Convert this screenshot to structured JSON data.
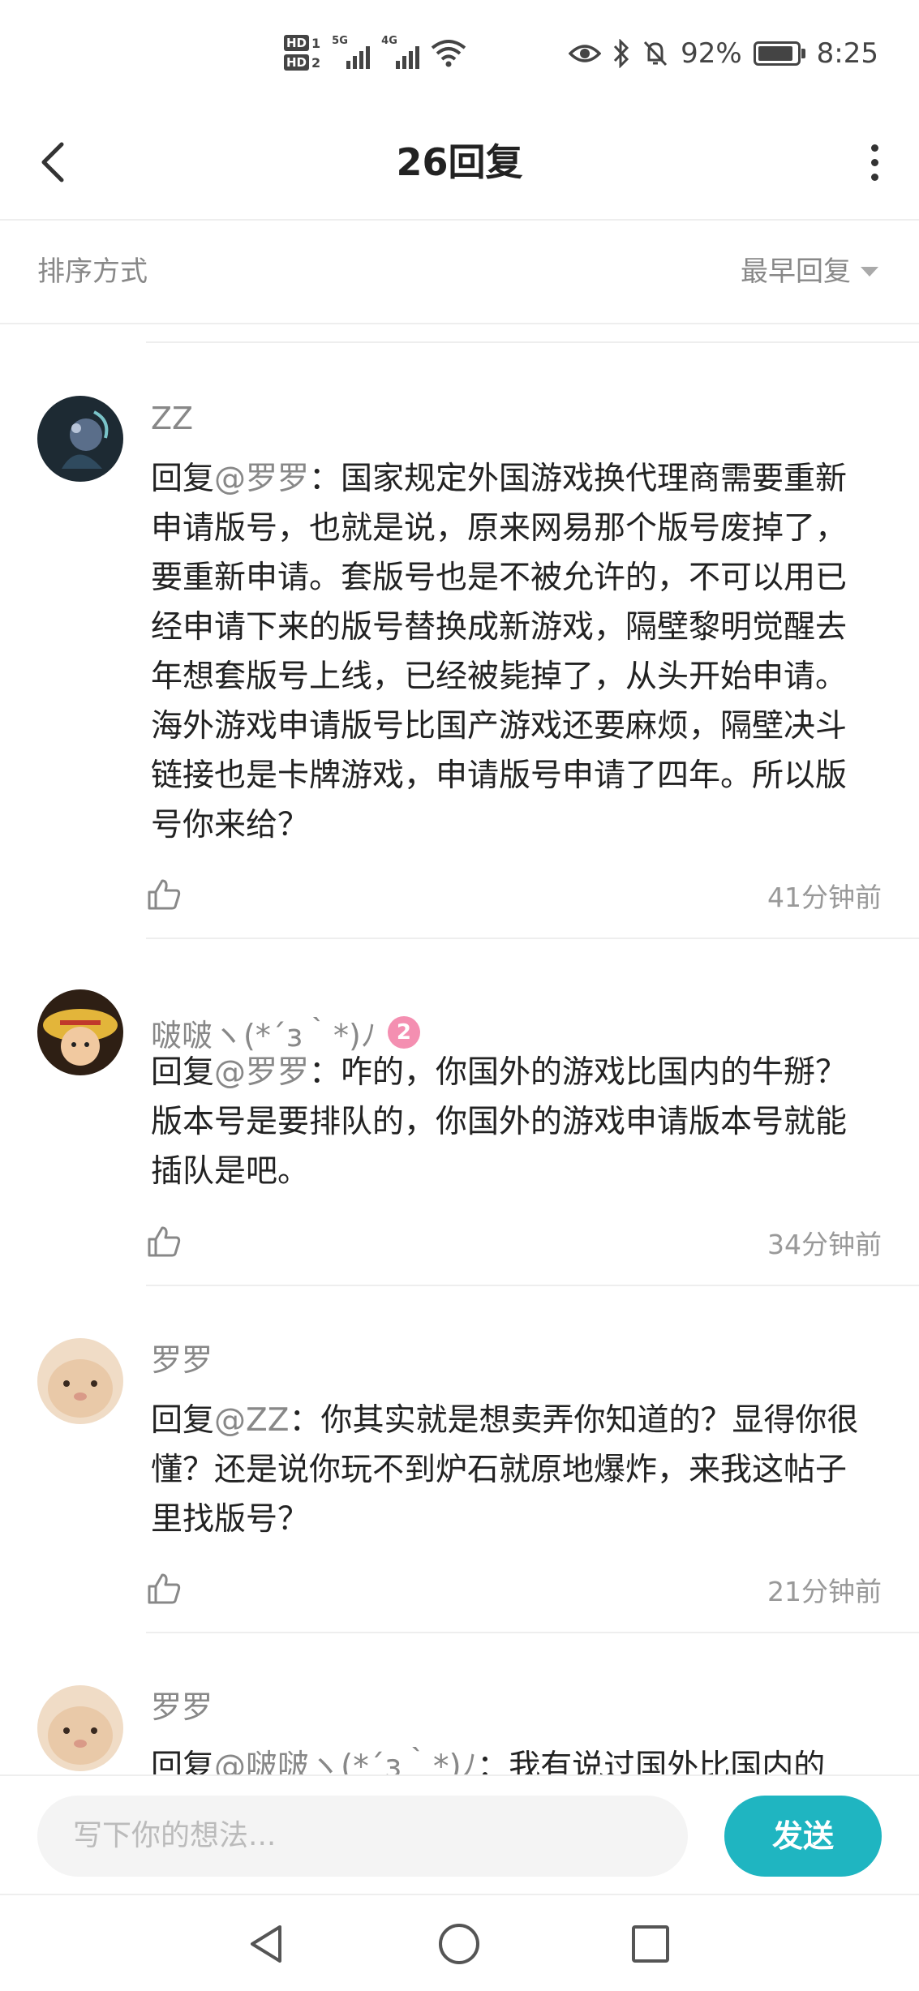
{
  "status_bar": {
    "hd1": "HD",
    "hd1_num": "1",
    "hd2": "HD",
    "hd2_num": "2",
    "sig1_label": "5G",
    "sig2_label": "4G",
    "battery_percent": "92%",
    "battery_level": 0.92,
    "time": "8:25"
  },
  "header": {
    "title": "26回复"
  },
  "sort": {
    "label": "排序方式",
    "value": "最早回复"
  },
  "comments": [
    {
      "name": "ZZ",
      "reply_prefix": "回复",
      "mention": "@罗罗",
      "text": "：国家规定外国游戏换代理商需要重新申请版号，也就是说，原来网易那个版号废掉了，要重新申请。套版号也是不被允许的，不可以用已经申请下来的版号替换成新游戏，隔壁黎明觉醒去年想套版号上线，已经被毙掉了，从头开始申请。海外游戏申请版号比国产游戏还要麻烦，隔壁决斗链接也是卡牌游戏，申请版号申请了四年。所以版号你来给？",
      "time": "41分钟前",
      "avatar_color": "#1d2a33"
    },
    {
      "name": "啵啵ヽ(*´з｀*)ﾉ",
      "badge": "2",
      "reply_prefix": "回复",
      "mention": "@罗罗",
      "text": "：咋的，你国外的游戏比国内的牛掰？版本号是要排队的，你国外的游戏申请版本号就能插队是吧。",
      "time": "34分钟前",
      "avatar_color": "#d4a23a"
    },
    {
      "name": "罗罗",
      "reply_prefix": "回复",
      "mention": "@ZZ",
      "text": "：你其实就是想卖弄你知道的？显得你很懂？还是说你玩不到炉石就原地爆炸，来我这帖子里找版号？",
      "time": "21分钟前",
      "avatar_color": "#e9c9a8"
    },
    {
      "name": "罗罗",
      "reply_prefix": "回复",
      "mention": "@啵啵ヽ(*´з｀*)ﾉ",
      "text": "：我有说过国外比国内的",
      "avatar_color": "#e9c9a8"
    }
  ],
  "input": {
    "placeholder": "写下你的想法...",
    "send_label": "发送"
  },
  "icons": {
    "back": "back-arrow-icon",
    "more": "more-vertical-icon",
    "like": "thumbs-up-icon",
    "nav_back": "nav-back-icon",
    "nav_home": "nav-home-icon",
    "nav_recent": "nav-recent-icon"
  },
  "colors": {
    "accent": "#1fb5c1",
    "mention": "#888888",
    "badge": "#f48fb1"
  }
}
